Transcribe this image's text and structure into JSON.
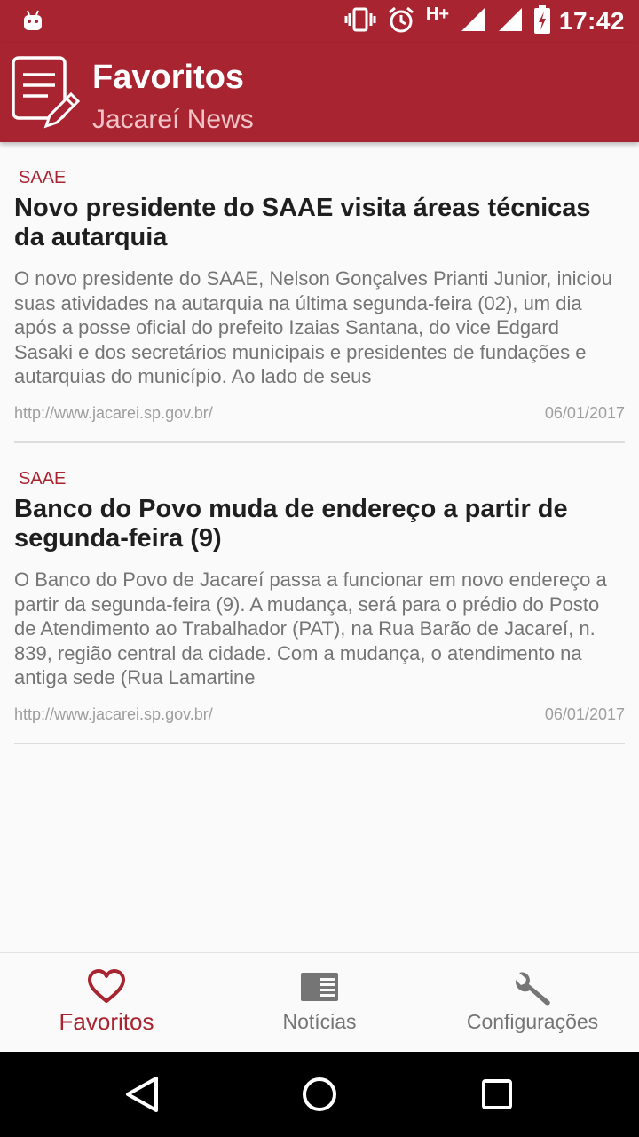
{
  "status_bar": {
    "time": "17:42",
    "network": "H+"
  },
  "app_bar": {
    "title": "Favoritos",
    "subtitle": "Jacareí News"
  },
  "articles": [
    {
      "category": "SAAE",
      "headline": "Novo presidente do SAAE visita áreas técnicas da autarquia",
      "summary": "O novo presidente do SAAE, Nelson Gonçalves Prianti Junior, iniciou suas atividades na autarquia na última segunda-feira (02), um dia após a posse oficial do prefeito Izaias Santana, do vice Edgard Sasaki e dos secretários municipais e presidentes de fundações e autarquias do município. Ao lado de seus",
      "source": "http://www.jacarei.sp.gov.br/",
      "date": "06/01/2017"
    },
    {
      "category": "SAAE",
      "headline": "Banco do Povo muda de endereço a partir de segunda-feira (9)",
      "summary": "O Banco do Povo de Jacareí passa a funcionar em novo endereço a partir da segunda-feira (9). A mudança, será para o prédio do Posto de Atendimento ao Trabalhador (PAT), na Rua Barão de Jacareí, n. 839, região central da cidade. Com a mudança, o atendimento na antiga sede (Rua Lamartine",
      "source": "http://www.jacarei.sp.gov.br/",
      "date": "06/01/2017"
    }
  ],
  "bottom_nav": {
    "items": [
      {
        "label": "Favoritos",
        "icon": "heart-icon",
        "active": true
      },
      {
        "label": "Notícias",
        "icon": "news-icon",
        "active": false
      },
      {
        "label": "Configurações",
        "icon": "wrench-icon",
        "active": false
      }
    ]
  },
  "colors": {
    "primary": "#a82430",
    "subtitle": "#f2c4c8",
    "inactive": "#757575"
  }
}
